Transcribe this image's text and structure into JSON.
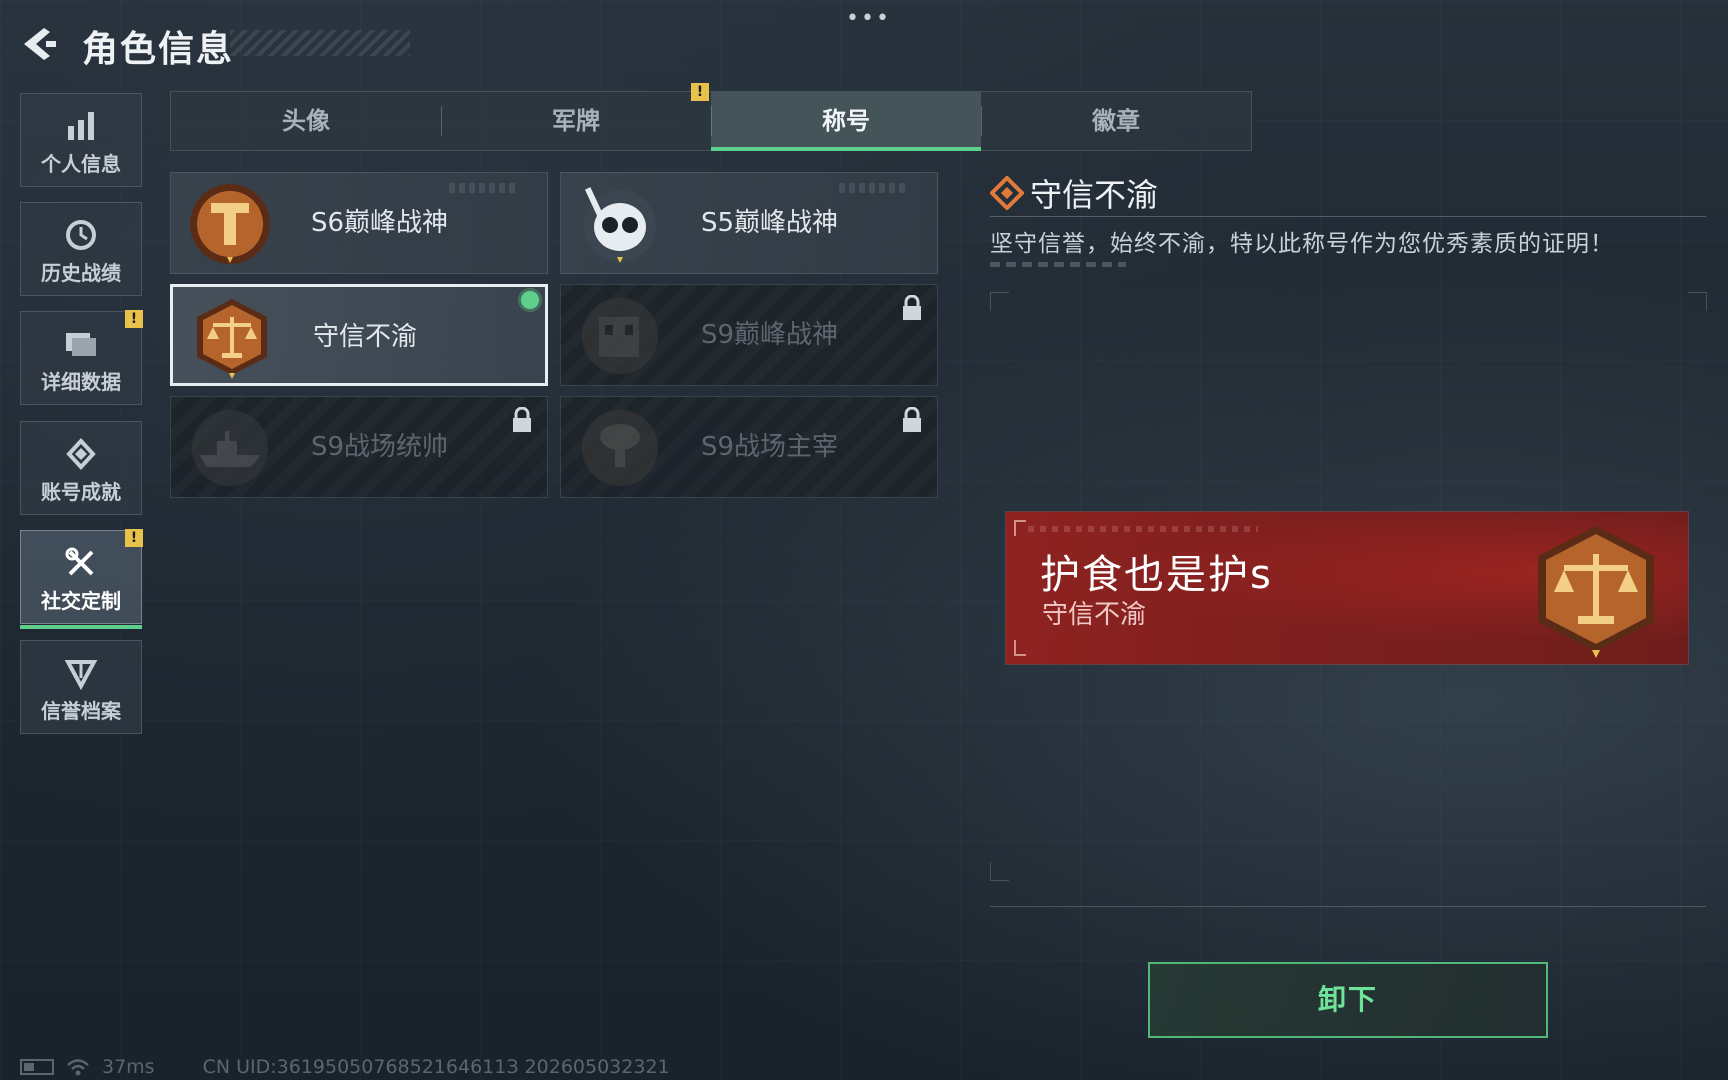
{
  "header": {
    "title": "角色信息",
    "more_glyph": "•••"
  },
  "sidebar": {
    "items": [
      {
        "label": "个人信息",
        "icon": "bar-chart-icon",
        "warn": false,
        "active": false
      },
      {
        "label": "历史战绩",
        "icon": "clock-icon",
        "warn": false,
        "active": false
      },
      {
        "label": "详细数据",
        "icon": "folder-icon",
        "warn": true,
        "active": false
      },
      {
        "label": "账号成就",
        "icon": "achievement-icon",
        "warn": false,
        "active": false
      },
      {
        "label": "社交定制",
        "icon": "tools-icon",
        "warn": true,
        "active": true
      },
      {
        "label": "信誉档案",
        "icon": "shield-icon",
        "warn": false,
        "active": false
      }
    ],
    "warn_glyph": "!"
  },
  "tabs": {
    "items": [
      "头像",
      "军牌",
      "称号",
      "徽章"
    ],
    "active_index": 2,
    "warn_glyph": "!"
  },
  "titles": {
    "cards": [
      {
        "label": "S6巅峰战神",
        "locked": false,
        "selected": false,
        "equipped": false,
        "emblem": "t-shield-emblem"
      },
      {
        "label": "S5巅峰战神",
        "locked": false,
        "selected": false,
        "equipped": false,
        "emblem": "skull-diver-emblem"
      },
      {
        "label": "守信不渝",
        "locked": false,
        "selected": true,
        "equipped": true,
        "emblem": "scales-emblem"
      },
      {
        "label": "S9巅峰战神",
        "locked": true,
        "selected": false,
        "equipped": false,
        "emblem": "building-emblem"
      },
      {
        "label": "S9战场统帅",
        "locked": true,
        "selected": false,
        "equipped": false,
        "emblem": "ship-emblem"
      },
      {
        "label": "S9战场主宰",
        "locked": true,
        "selected": false,
        "equipped": false,
        "emblem": "mushroom-cloud-emblem"
      }
    ]
  },
  "detail": {
    "title": "守信不渝",
    "description": "坚守信誉，始终不渝，特以此称号作为您优秀素质的证明！"
  },
  "preview": {
    "player_name": "护食也是护s",
    "title": "守信不渝"
  },
  "actions": {
    "unequip_label": "卸下"
  },
  "status": {
    "ping": "37ms",
    "uid": "CN UID:3619505076852164611З 202605032321"
  },
  "colors": {
    "accent_green": "#5ed08b",
    "warn_yellow": "#e8c24a",
    "banner_red": "#8f2321",
    "emblem_bronze": "#b5652c"
  }
}
